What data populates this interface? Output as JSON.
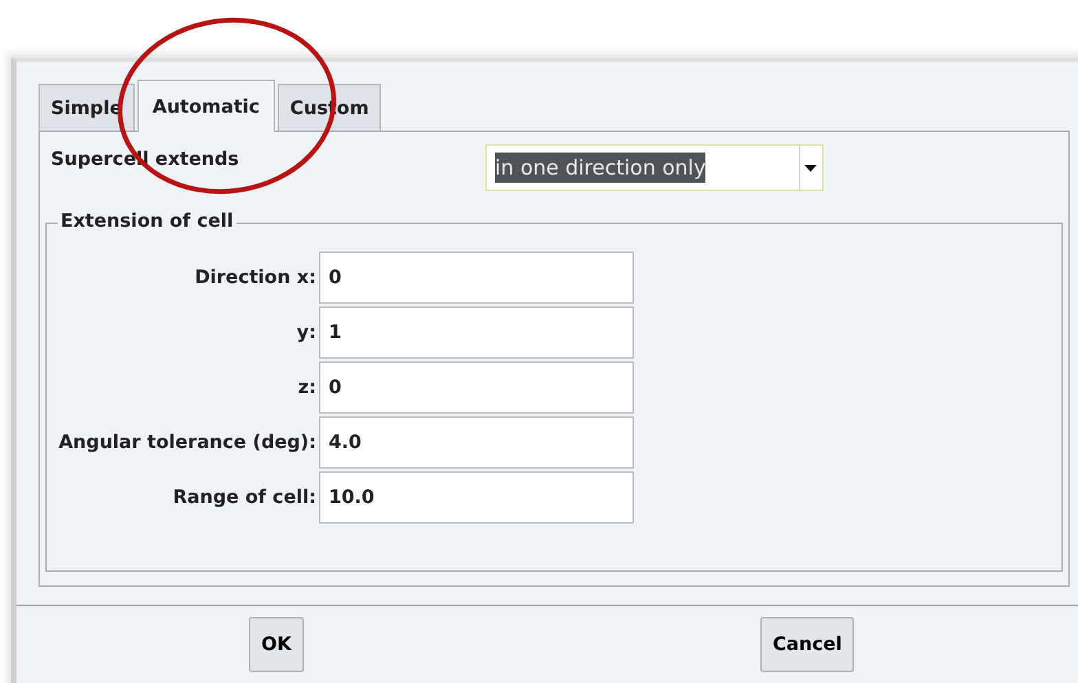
{
  "tabs": [
    {
      "label": "Simple",
      "selected": false
    },
    {
      "label": "Automatic",
      "selected": true
    },
    {
      "label": "Custom",
      "selected": false
    }
  ],
  "supercell": {
    "label": "Supercell extends",
    "value": "in one direction only",
    "text_highlighted": true
  },
  "extension_group": {
    "title": "Extension of cell",
    "fields": [
      {
        "label": "Direction x:",
        "value": "0"
      },
      {
        "label": "y:",
        "value": "1"
      },
      {
        "label": "z:",
        "value": "0"
      },
      {
        "label": "Angular tolerance (deg):",
        "value": "4.0"
      },
      {
        "label": "Range of cell:",
        "value": "10.0"
      }
    ]
  },
  "buttons": [
    "OK",
    "Cancel"
  ]
}
